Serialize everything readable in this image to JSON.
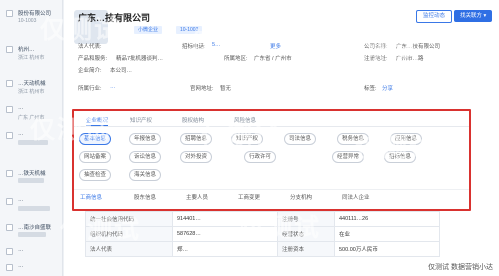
{
  "sidebar": {
    "items": [
      {
        "title": "股份有限公司",
        "sub": "10-1003"
      },
      {
        "title": "杭州…",
        "sub": "浙江 杭州市"
      },
      {
        "title": "…天动机械",
        "sub": "浙江 杭州市"
      },
      {
        "title": "…",
        "sub": "广东 广州市"
      },
      {
        "title": "…"
      },
      {
        "title": "…铁天机械"
      },
      {
        "title": "…"
      },
      {
        "title": "…南沙自盛联"
      },
      {
        "title": "…"
      },
      {
        "title": "…"
      }
    ]
  },
  "header": {
    "company": "广东…技有限公司",
    "tags": [
      "小微企业",
      "10-1003"
    ],
    "btn_monitor": "监控动态",
    "btn_related": "找关联方 ▾"
  },
  "info": {
    "legal_rep_label": "法人代表:",
    "phone_label": "招标电话:",
    "phone_value": "5…",
    "phone_more": "更多",
    "products_label": "产品和服务:",
    "products_value": "精品7批机器谈判…",
    "region_label": "所属地区:",
    "region_value": "广东省 / 广州市",
    "company_name_label": "公司名称:",
    "company_name_value": "广东…技有限公司",
    "address_label": "注册地址:",
    "address_value": "广州市…路",
    "profile_label": "企业简介:",
    "profile_value": "本公司…",
    "industry_label": "所属行业:",
    "industry_value": "…",
    "website_label": "官网地址:",
    "website_value": "暂无",
    "share_label": "分享",
    "tag_label": "标签:"
  },
  "panel": {
    "tabs": [
      "企业概况",
      "知识产权",
      "股权结构",
      "风险信息"
    ],
    "chips_row1": [
      "基本信息",
      "年报信息",
      "招聘信息",
      "知识产权",
      "司法信息",
      "税务信息",
      "应用信息"
    ],
    "chips_row2": [
      "网站备案",
      "诉讼信息",
      "对外投资",
      "行政许可",
      "经营异常",
      "招标信息"
    ],
    "chips_row3": [
      "抽查检查",
      "海关信息"
    ],
    "sub_tabs": [
      "工商信息",
      "股东信息",
      "主要人员",
      "工商变更",
      "分支机构",
      "同法人企业"
    ]
  },
  "table": {
    "rows": [
      [
        "统一社会信用代码",
        "914401…",
        "注册号",
        "440111…26"
      ],
      [
        "组织机构代码",
        "587628…",
        "经营状态",
        "在业"
      ],
      [
        "法人代表",
        "郑…",
        "注册资本",
        "500.00万人民币"
      ]
    ]
  },
  "watermarks": [
    "仅测试",
    "仅测试",
    "仅测试",
    "仅测试",
    "仅测试",
    "仅测试",
    "仅测试",
    "仅测试"
  ],
  "footer_watermark": "仅测试 数据营销小达"
}
